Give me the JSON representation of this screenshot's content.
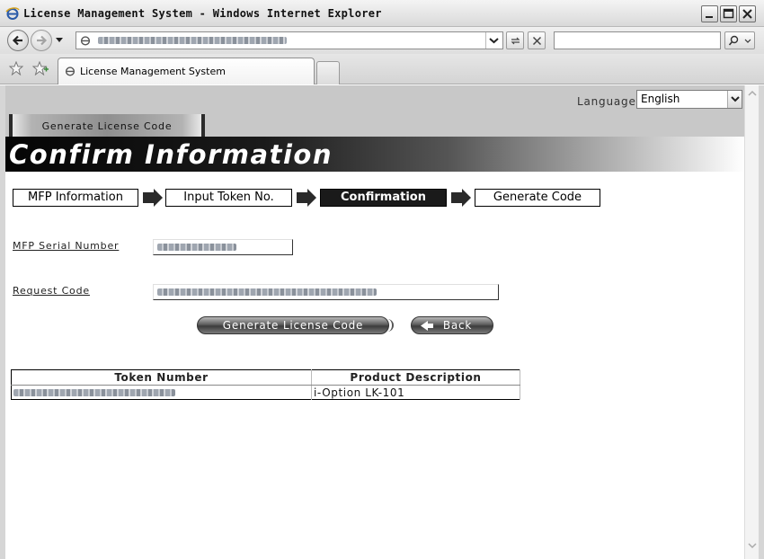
{
  "window": {
    "title": "License Management System - Windows Internet Explorer"
  },
  "browser": {
    "address_value": "",
    "search_value": "",
    "tab_label": "License Management System"
  },
  "page": {
    "language_label": "Language",
    "language_value": "English",
    "section_tab": "Generate License Code",
    "heading": "Confirm Information",
    "steps": [
      {
        "label": "MFP Information",
        "active": false
      },
      {
        "label": "Input Token No.",
        "active": false
      },
      {
        "label": "Confirmation",
        "active": true
      },
      {
        "label": "Generate Code",
        "active": false
      }
    ],
    "fields": {
      "serial_label": "MFP Serial Number",
      "request_label": "Request Code"
    },
    "buttons": {
      "generate": "Generate License Code",
      "back": "Back"
    },
    "table": {
      "headers": [
        "Token Number",
        "Product Description"
      ],
      "rows": [
        {
          "token": "",
          "product": "i-Option LK-101"
        }
      ]
    }
  },
  "colors": {
    "active_step": "#1a1a1a",
    "header_band": "#c8c8c8"
  },
  "icons": [
    "ie-logo-icon",
    "minimize-icon",
    "maximize-icon",
    "close-icon",
    "back-nav-icon",
    "forward-nav-icon",
    "dropdown-icon",
    "refresh-icon",
    "stop-icon",
    "search-icon",
    "favorites-star-icon",
    "add-favorites-icon",
    "step-arrow-icon",
    "back-arrow-icon"
  ]
}
